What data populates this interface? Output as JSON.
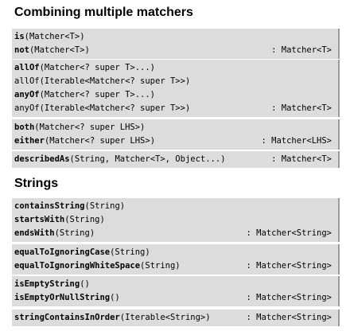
{
  "sections": [
    {
      "title": "Combining multiple matchers",
      "groups": [
        {
          "lines": [
            {
              "name": "is",
              "args": "(Matcher<T>)",
              "returns": ""
            },
            {
              "name": "not",
              "args": "(Matcher<T>)",
              "returns": ": Matcher<T>"
            }
          ]
        },
        {
          "lines": [
            {
              "name": "allOf",
              "args": "(Matcher<? super T>...)",
              "returns": ""
            },
            {
              "name": "allOf",
              "args": "(Iterable<Matcher<? super T>>)",
              "returns": "",
              "bold": false
            },
            {
              "name": "anyOf",
              "args": "(Matcher<? super T>...)",
              "returns": ""
            },
            {
              "name": "anyOf",
              "args": "(Iterable<Matcher<? super T>>)",
              "returns": ": Matcher<T>",
              "bold": false
            }
          ]
        },
        {
          "lines": [
            {
              "name": "both",
              "args": "(Matcher<? super LHS>)",
              "returns": ""
            },
            {
              "name": "either",
              "args": "(Matcher<? super LHS>)",
              "returns": ": Matcher<LHS>"
            }
          ]
        },
        {
          "lines": [
            {
              "name": "describedAs",
              "args": "(String, Matcher<T>, Object...)",
              "returns": ": Matcher<T>"
            }
          ]
        }
      ]
    },
    {
      "title": "Strings",
      "groups": [
        {
          "lines": [
            {
              "name": "containsString",
              "args": "(String)",
              "returns": ""
            },
            {
              "name": "startsWith",
              "args": "(String)",
              "returns": ""
            },
            {
              "name": "endsWith",
              "args": "(String)",
              "returns": ": Matcher<String>"
            }
          ]
        },
        {
          "lines": [
            {
              "name": "equalToIgnoringCase",
              "args": "(String)",
              "returns": ""
            },
            {
              "name": "equalToIgnoringWhiteSpace",
              "args": "(String)",
              "returns": ": Matcher<String>"
            }
          ]
        },
        {
          "lines": [
            {
              "name": "isEmptyString",
              "args": "()",
              "returns": ""
            },
            {
              "name": "isEmptyOrNullString",
              "args": "()",
              "returns": ": Matcher<String>"
            }
          ]
        },
        {
          "lines": [
            {
              "name": "stringContainsInOrder",
              "args": "(Iterable<String>)",
              "returns": ": Matcher<String>"
            }
          ]
        }
      ]
    }
  ]
}
